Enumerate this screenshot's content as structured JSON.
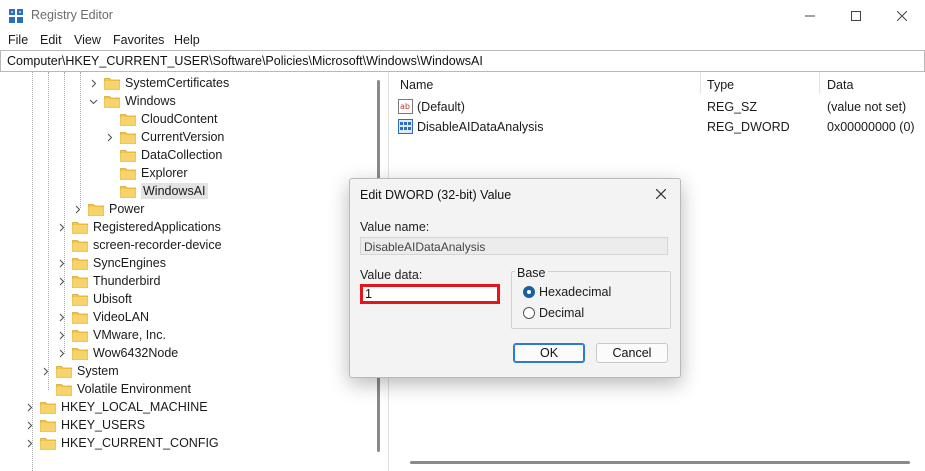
{
  "window": {
    "title": "Registry Editor"
  },
  "menu": [
    "File",
    "Edit",
    "View",
    "Favorites",
    "Help"
  ],
  "address": "Computer\\HKEY_CURRENT_USER\\Software\\Policies\\Microsoft\\Windows\\WindowsAI",
  "tree": [
    {
      "label": "SystemCertificates",
      "level": 4,
      "chevron": "right"
    },
    {
      "label": "Windows",
      "level": 4,
      "chevron": "down"
    },
    {
      "label": "CloudContent",
      "level": 5,
      "chevron": "none"
    },
    {
      "label": "CurrentVersion",
      "level": 5,
      "chevron": "right"
    },
    {
      "label": "DataCollection",
      "level": 5,
      "chevron": "none"
    },
    {
      "label": "Explorer",
      "level": 5,
      "chevron": "none"
    },
    {
      "label": "WindowsAI",
      "level": 5,
      "chevron": "none",
      "selected": true
    },
    {
      "label": "Power",
      "level": 3,
      "chevron": "right"
    },
    {
      "label": "RegisteredApplications",
      "level": 2,
      "chevron": "right"
    },
    {
      "label": "screen-recorder-device",
      "level": 2,
      "chevron": "none"
    },
    {
      "label": "SyncEngines",
      "level": 2,
      "chevron": "right"
    },
    {
      "label": "Thunderbird",
      "level": 2,
      "chevron": "right"
    },
    {
      "label": "Ubisoft",
      "level": 2,
      "chevron": "none"
    },
    {
      "label": "VideoLAN",
      "level": 2,
      "chevron": "right"
    },
    {
      "label": "VMware, Inc.",
      "level": 2,
      "chevron": "right"
    },
    {
      "label": "Wow6432Node",
      "level": 2,
      "chevron": "right"
    },
    {
      "label": "System",
      "level": 1,
      "chevron": "right"
    },
    {
      "label": "Volatile Environment",
      "level": 1,
      "chevron": "none"
    },
    {
      "label": "HKEY_LOCAL_MACHINE",
      "level": 0,
      "chevron": "right"
    },
    {
      "label": "HKEY_USERS",
      "level": 0,
      "chevron": "right"
    },
    {
      "label": "HKEY_CURRENT_CONFIG",
      "level": 0,
      "chevron": "right"
    }
  ],
  "list": {
    "columns": [
      "Name",
      "Type",
      "Data"
    ],
    "rows": [
      {
        "icon": "string-value-icon",
        "name": "(Default)",
        "type": "REG_SZ",
        "data": "(value not set)"
      },
      {
        "icon": "dword-value-icon",
        "name": "DisableAIDataAnalysis",
        "type": "REG_DWORD",
        "data": "0x00000000 (0)"
      }
    ]
  },
  "dialog": {
    "title": "Edit DWORD (32-bit) Value",
    "value_name_label": "Value name:",
    "value_name": "DisableAIDataAnalysis",
    "value_data_label": "Value data:",
    "value_data": "1",
    "base_label": "Base",
    "base_options": [
      "Hexadecimal",
      "Decimal"
    ],
    "base_selected": "Hexadecimal",
    "ok_label": "OK",
    "cancel_label": "Cancel"
  },
  "colors": {
    "highlight_border": "#e3171b",
    "folder": "#f3c64b",
    "accent": "#1a5fa0"
  }
}
